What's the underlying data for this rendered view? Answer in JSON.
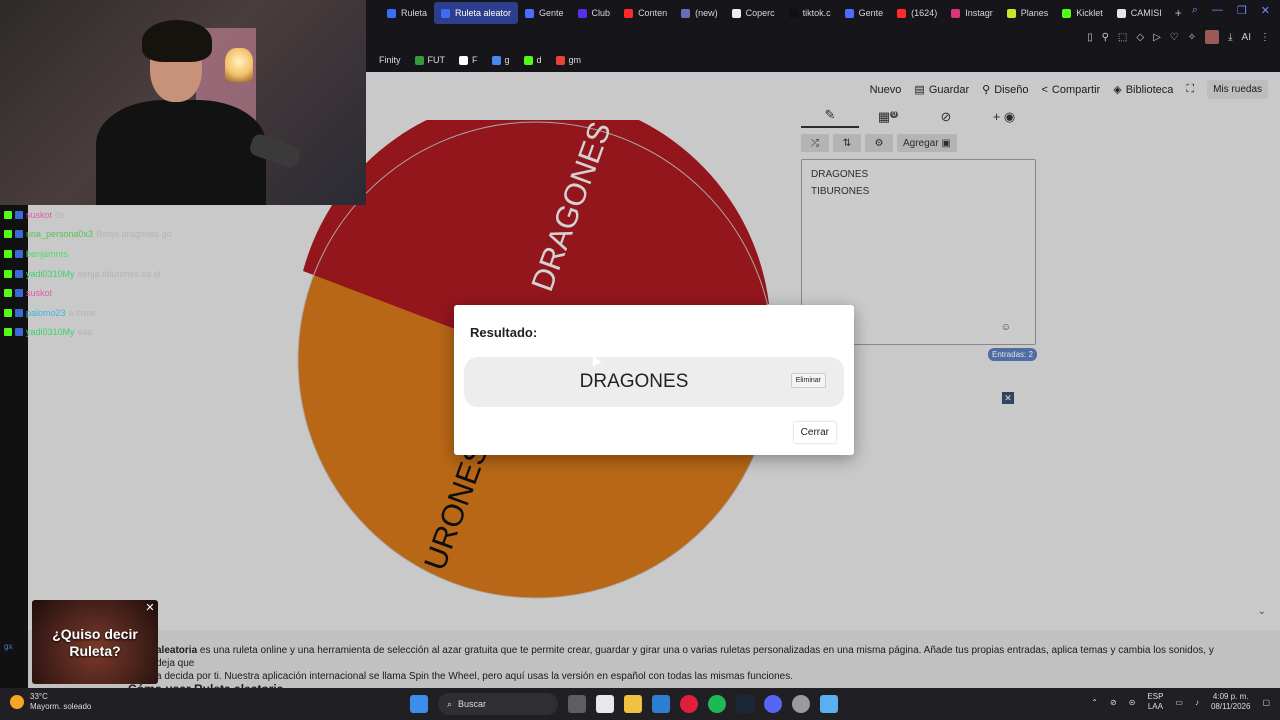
{
  "browser": {
    "tabs": [
      {
        "label": "Ruleta",
        "color": "#3b6df5",
        "active": false
      },
      {
        "label": "Ruleta aleator",
        "color": "#3b6df5",
        "active": true
      },
      {
        "label": "Gente",
        "color": "#4e6cff",
        "active": false
      },
      {
        "label": "Club",
        "color": "#5a2cf0",
        "active": false
      },
      {
        "label": "Conten",
        "color": "#ff2a2a",
        "active": false
      },
      {
        "label": "(new)",
        "color": "#6b6bb8",
        "active": false
      },
      {
        "label": "Coperc",
        "color": "#eeeeee",
        "active": false
      },
      {
        "label": "tiktok.c",
        "color": "#111111",
        "active": false
      },
      {
        "label": "Gente",
        "color": "#4e6cff",
        "active": false
      },
      {
        "label": "(1624)",
        "color": "#ff2a2a",
        "active": false
      },
      {
        "label": "Instagr",
        "color": "#d9357b",
        "active": false
      },
      {
        "label": "Planes",
        "color": "#c7e82a",
        "active": false
      },
      {
        "label": "Kicklet",
        "color": "#53fc18",
        "active": false
      },
      {
        "label": "CAMISI",
        "color": "#e6e6e6",
        "active": false
      }
    ],
    "new_tab": "+",
    "toolbar_icons": [
      "panel-icon",
      "pin-icon",
      "screenshot-icon",
      "shield-icon",
      "play-icon",
      "heart-icon",
      "extensions-icon",
      "profile-avatar",
      "download-icon",
      "ai-icon",
      "menu-icon"
    ],
    "ai_label": "AI",
    "bookmarks": [
      {
        "label": "Finity",
        "color": "#16161a"
      },
      {
        "label": "FUT",
        "color": "#3a9a3a"
      },
      {
        "label": "F",
        "color": "#ffffff"
      },
      {
        "label": "g",
        "color": "#4a8af0"
      },
      {
        "label": "d",
        "color": "#53fc18"
      },
      {
        "label": "gm",
        "color": "#ea4335"
      }
    ]
  },
  "app": {
    "menu": [
      {
        "label": "Nuevo",
        "icon": ""
      },
      {
        "label": "Guardar",
        "icon": "save-icon"
      },
      {
        "label": "Diseño",
        "icon": "brush-icon"
      },
      {
        "label": "Compartir",
        "icon": "share-icon"
      },
      {
        "label": "Biblioteca",
        "icon": "library-icon"
      }
    ],
    "fullscreen_icon": "fullscreen-icon",
    "mis_ruedas": "Mis ruedas",
    "editor": {
      "tab_icons": [
        "pencil-icon",
        "clipboard-icon",
        "eye-off-icon",
        "add-palette-icon"
      ],
      "clipboard_badge": "0",
      "buttons": [
        {
          "label": "",
          "icon": "shuffle-icon"
        },
        {
          "label": "",
          "icon": "sort-icon"
        },
        {
          "label": "",
          "icon": "settings-icon"
        },
        {
          "label": "Agregar",
          "icon": "image-icon"
        }
      ],
      "entries": [
        "DRAGONES",
        "TIBURONES"
      ],
      "count_label": "Entradas: 2"
    },
    "wheel": {
      "segments": [
        {
          "label": "DRAGONES",
          "color": "#a81a22"
        },
        {
          "label": "TIBURONES",
          "color": "#d2761a"
        }
      ],
      "visible_labels": [
        "DRAGONES",
        "URONES"
      ]
    },
    "bottom": {
      "text_bold": "aleatoria",
      "text_line1": " es una ruleta online y una herramienta de selección al azar gratuita que te permite crear, guardar y girar una o varias ruletas personalizadas en una misma página. Añade tus propias entradas, aplica temas y cambia los sonidos, y deja que",
      "text_line2": "a decida por ti. Nuestra aplicación internacional se llama Spin the Wheel, pero aquí usas la versión en español con todas las mismas funciones.",
      "heading": "Cómo usar Ruleta aleatoria"
    }
  },
  "dialog": {
    "title": "Resultado:",
    "result": "DRAGONES",
    "delete_label": "Eliminar",
    "close_label": "Cerrar"
  },
  "chat": [
    {
      "user": "suskot",
      "user_color": "#e05ab0",
      "msg": "de"
    },
    {
      "user": "una_persona0x3",
      "user_color": "#53c653",
      "msg": "Benja dragones go"
    },
    {
      "user": "benjamnrs",
      "user_color": "#4fd96b",
      "msg": ""
    },
    {
      "user": "yadi0310My",
      "user_color": "#3ad36b",
      "msg": "benja tiburones xd el"
    },
    {
      "user": "suskot",
      "user_color": "#e05ab0",
      "msg": ""
    },
    {
      "user": "palomo23",
      "user_color": "#3ab5e0",
      "msg": "a crear"
    },
    {
      "user": "yadi0310My",
      "user_color": "#3ad36b",
      "msg": "aaa"
    }
  ],
  "promo": {
    "text": "¿Quiso decir Ruleta?"
  },
  "taskbar": {
    "weather_temp": "33°C",
    "weather_desc": "Mayorm. soleado",
    "search_label": "Buscar",
    "lang_top": "ESP",
    "lang_bottom": "LAA",
    "time": "4:09 p. m.",
    "date": "08/11/2026"
  },
  "side_label": "gx"
}
